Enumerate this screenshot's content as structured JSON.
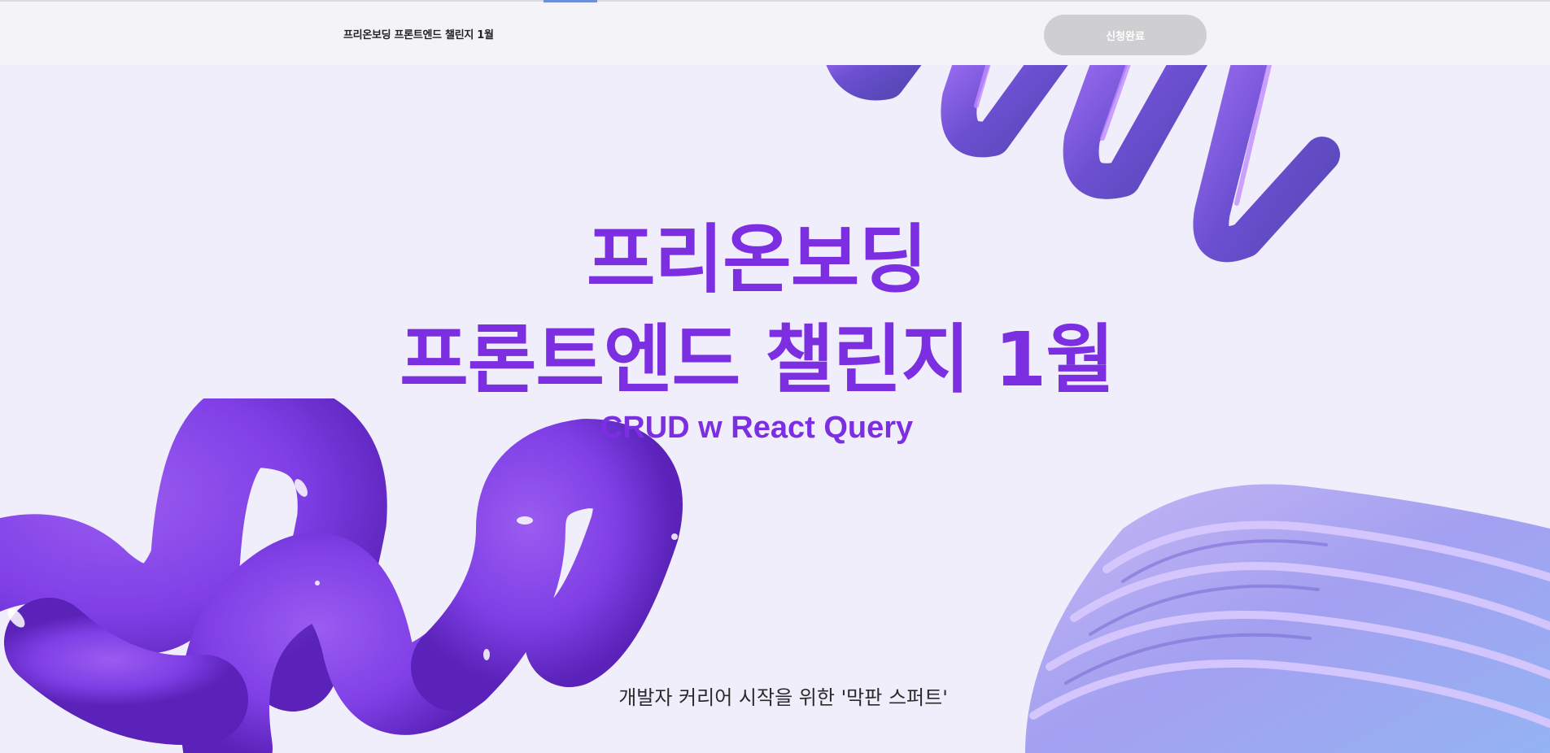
{
  "header": {
    "brand": "프리온보딩 프론트엔드 챌린지 1월",
    "apply_button": "신청완료"
  },
  "hero": {
    "title_line1": "프리온보딩",
    "title_line2": "프론트엔드 챌린지 1월",
    "subtitle": "CRUD w React Query",
    "tagline": "개발자 커리어 시작을 위한 '막판 스퍼트'"
  },
  "colors": {
    "accent": "#7b2fe0",
    "background": "#f1eefc",
    "button_disabled": "#cfcfd2"
  },
  "decorations": [
    "purple-spring-top-right",
    "purple-tube-bottom-left",
    "lavender-waves-bottom-right"
  ]
}
